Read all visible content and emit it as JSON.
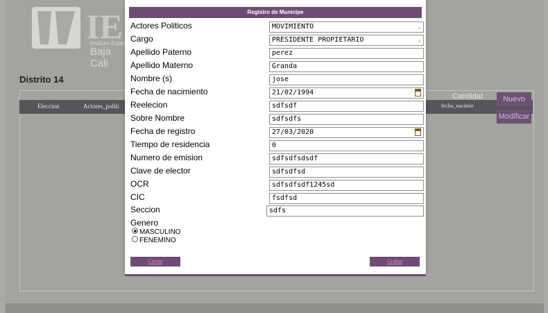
{
  "background": {
    "logo": {
      "text": "IE",
      "line1": "Instituto Estatal",
      "line2": "Baja Cali"
    },
    "distrito": "Distrito 14",
    "table_headers": [
      "Eleccion",
      "Actores_politi"
    ],
    "candidat_label": "Candidat",
    "fecha_label": "fecha_nacimie",
    "buttons": {
      "nuevo": "Nuevo",
      "modificar": "Modificar"
    }
  },
  "modal": {
    "title": "Registro de Municipe",
    "fields": {
      "actores_politicos": {
        "label": "Actores Politicos",
        "value": "MOVIMIENTO"
      },
      "cargo": {
        "label": "Cargo",
        "value": "PRESIDENTE PROPIETARIO"
      },
      "apellido_paterno": {
        "label": "Apellido Paterno",
        "value": "perez"
      },
      "apellido_materno": {
        "label": "Apellido Materno",
        "value": "Granda"
      },
      "nombre": {
        "label": "Nombre (s)",
        "value": "jose"
      },
      "fecha_nacimiento": {
        "label": "Fecha de nacimiento",
        "value": "21/02/1994"
      },
      "reelecion": {
        "label": "Reelecion",
        "value": "sdfsdf"
      },
      "sobre_nombre": {
        "label": "Sobre Nombre",
        "value": "sdfsdfs"
      },
      "fecha_registro": {
        "label": "Fecha de registro",
        "value": "27/03/2020"
      },
      "tiempo_residencia": {
        "label": "Tiempo de residencia",
        "value": "0"
      },
      "numero_emision": {
        "label": "Numero de emision",
        "value": "sdfsdfsdsdf"
      },
      "clave_elector": {
        "label": "Clave de elector",
        "value": "sdfsdfsd"
      },
      "ocr": {
        "label": "OCR",
        "value": "sdfsdfsdf1245sd"
      },
      "cic": {
        "label": "CIC",
        "value": "fsdfsd"
      },
      "seccion": {
        "label": "Seccion",
        "value": "sdfs"
      }
    },
    "genero": {
      "label": "Genero",
      "options": [
        "MASCULINO",
        "FENEMINO"
      ],
      "selected": "MASCULINO"
    },
    "buttons": {
      "cerrar": "Cerrar",
      "grabar": "Grabar"
    }
  },
  "colors": {
    "accent": "#6e4c76",
    "link": "#e88aa6",
    "overlay": "#a9aaa5"
  }
}
